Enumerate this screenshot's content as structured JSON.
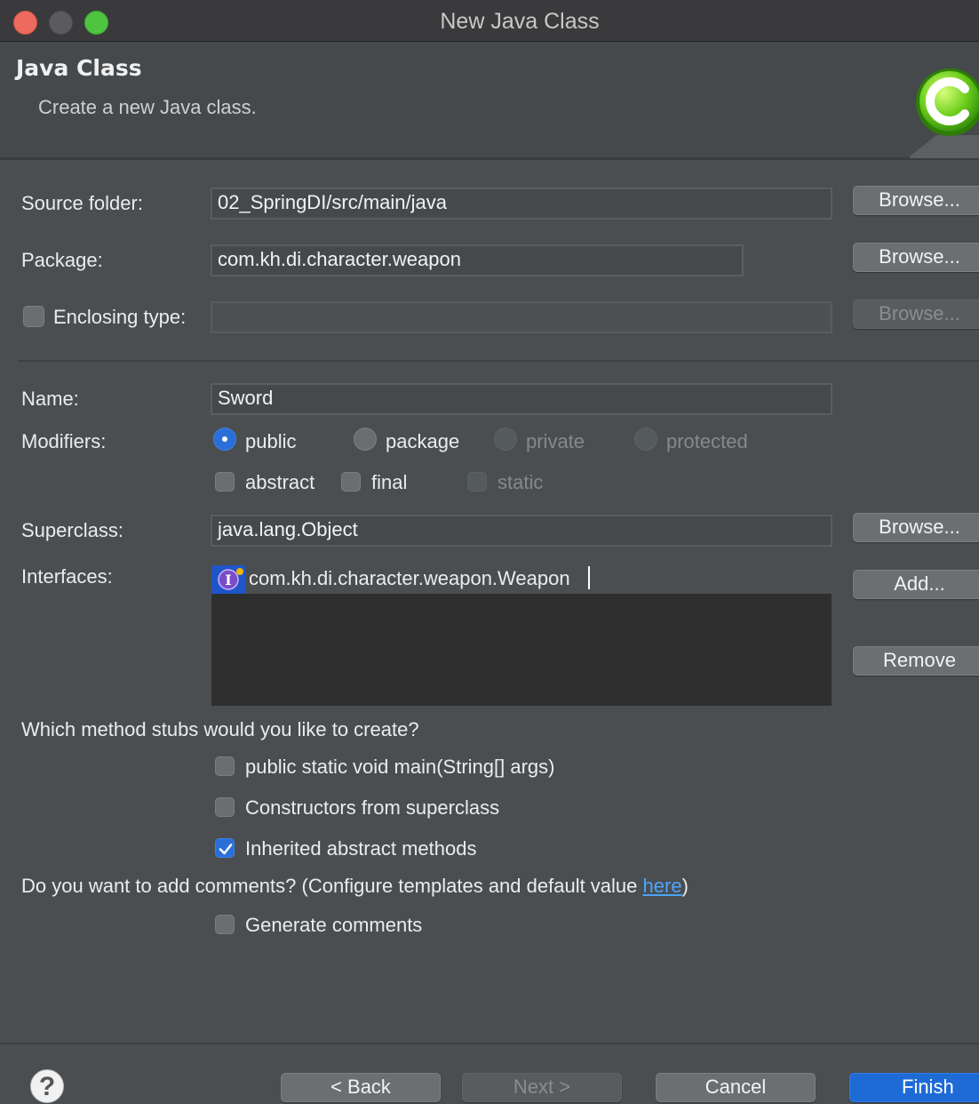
{
  "window": {
    "title": "New Java Class"
  },
  "banner": {
    "title": "Java Class",
    "description": "Create a new Java class."
  },
  "source_folder": {
    "label": "Source folder:",
    "value": "02_SpringDI/src/main/java",
    "browse_label": "Browse..."
  },
  "package": {
    "label": "Package:",
    "value": "com.kh.di.character.weapon",
    "browse_label": "Browse..."
  },
  "enclosing_type": {
    "label": "Enclosing type:",
    "value": "",
    "checked": false,
    "browse_label": "Browse..."
  },
  "name": {
    "label": "Name:",
    "value": "Sword"
  },
  "modifiers": {
    "label": "Modifiers:",
    "visibility": [
      {
        "label": "public",
        "selected": true,
        "enabled": true
      },
      {
        "label": "package",
        "selected": false,
        "enabled": true
      },
      {
        "label": "private",
        "selected": false,
        "enabled": false
      },
      {
        "label": "protected",
        "selected": false,
        "enabled": false
      }
    ],
    "flags": [
      {
        "label": "abstract",
        "checked": false,
        "enabled": true
      },
      {
        "label": "final",
        "checked": false,
        "enabled": true
      },
      {
        "label": "static",
        "checked": false,
        "enabled": false
      }
    ]
  },
  "superclass": {
    "label": "Superclass:",
    "value": "java.lang.Object",
    "browse_label": "Browse..."
  },
  "interfaces": {
    "label": "Interfaces:",
    "items": [
      "com.kh.di.character.weapon.Weapon"
    ],
    "add_label": "Add...",
    "remove_label": "Remove",
    "icon": "interface-icon"
  },
  "method_stubs": {
    "question": "Which method stubs would you like to create?",
    "options": [
      {
        "label": "public static void main(String[] args)",
        "checked": false
      },
      {
        "label": "Constructors from superclass",
        "checked": false
      },
      {
        "label": "Inherited abstract methods",
        "checked": true
      }
    ]
  },
  "comments": {
    "question_prefix": "Do you want to add comments? (Configure templates and default value ",
    "link_text": "here",
    "question_suffix": ")",
    "option": {
      "label": "Generate comments",
      "checked": false
    }
  },
  "footer": {
    "help_icon": "help-icon",
    "help_glyph": "?",
    "back_label": "< Back",
    "next_label": "Next >",
    "cancel_label": "Cancel",
    "finish_label": "Finish"
  },
  "colors": {
    "accent": "#1f6bd6",
    "link": "#4aa6ff",
    "close": "#ed6a5e",
    "maximize": "#4ec440"
  }
}
